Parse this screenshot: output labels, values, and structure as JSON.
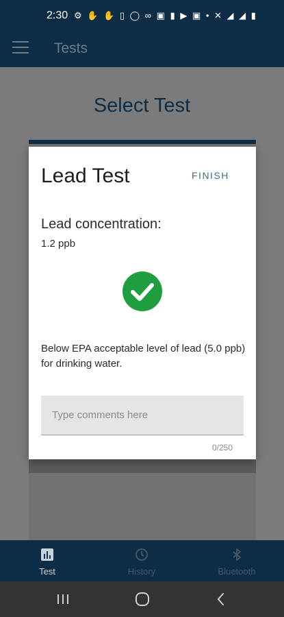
{
  "status_bar": {
    "time": "2:30",
    "icons": "⚙ ✋ ✋ ▯ ◯ ∞ ▣ ▮ ▶ ▣ •  ✕ ◢ ◢ ▮"
  },
  "app_bar": {
    "title": "Tests"
  },
  "page": {
    "heading": "Select Test"
  },
  "dialog": {
    "title": "Lead Test",
    "finish_label": "FINISH",
    "concentration_label": "Lead concentration:",
    "concentration_value": "1.2 ppb",
    "result_message": "Below EPA acceptable level of lead (5.0 ppb) for drinking water.",
    "comment_placeholder": "Type comments here",
    "comment_value": "",
    "char_count": "0/250",
    "status_color": "#1e9e3e"
  },
  "bottom_nav": {
    "items": [
      {
        "label": "Test",
        "icon": "bar-chart-icon",
        "active": true
      },
      {
        "label": "History",
        "icon": "history-icon",
        "active": false
      },
      {
        "label": "Bluetooth",
        "icon": "bluetooth-icon",
        "active": false
      }
    ]
  },
  "colors": {
    "primary": "#0c2d45",
    "accent": "#3f6f8c"
  }
}
